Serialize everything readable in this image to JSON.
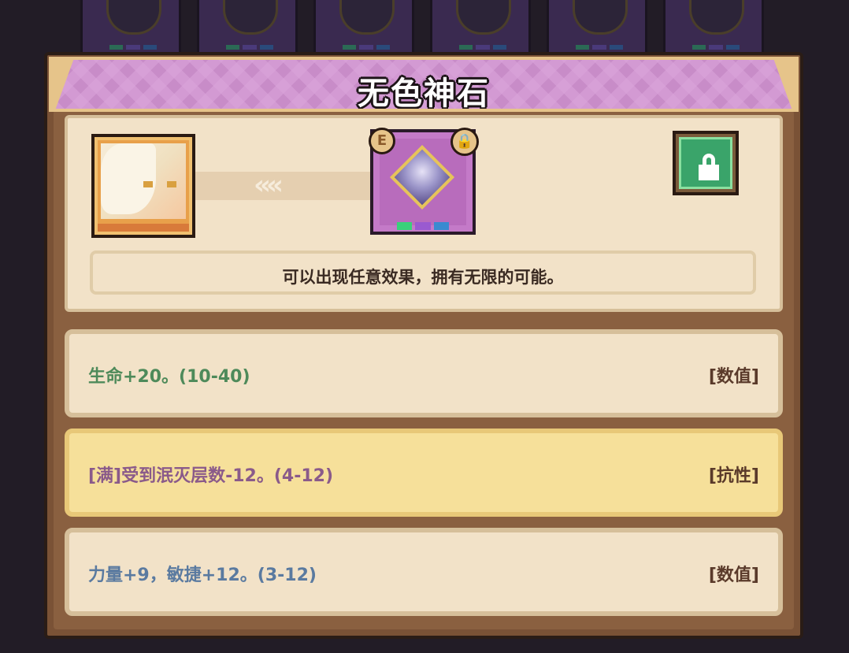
{
  "dialog": {
    "title": "无色神石",
    "description": "可以出现任意效果，拥有无限的可能。",
    "badge_e": "E",
    "lock_symbol": "🔒"
  },
  "arrows": "‹‹‹‹",
  "stats": [
    {
      "text": "生命+20。(10-40)",
      "tag": "[数值]",
      "color": "#4e8a5a",
      "highlighted": false
    },
    {
      "text": "[满]受到泯灭层数-12。(4-12)",
      "tag": "[抗性]",
      "color": "#8a5a8a",
      "highlighted": true
    },
    {
      "text": "力量+9，敏捷+12。(3-12)",
      "tag": "[数值]",
      "color": "#5a7aa0",
      "highlighted": false
    }
  ],
  "gem_dot_colors": [
    "#3ad07a",
    "#9a5ad0",
    "#3a8ad0"
  ],
  "colors": {
    "panel_brown": "#7a5236",
    "banner_purple": "#c88cc8",
    "cream": "#f2e2c8",
    "highlight_yellow": "#f6e09a",
    "lock_green": "#3aa46a"
  }
}
